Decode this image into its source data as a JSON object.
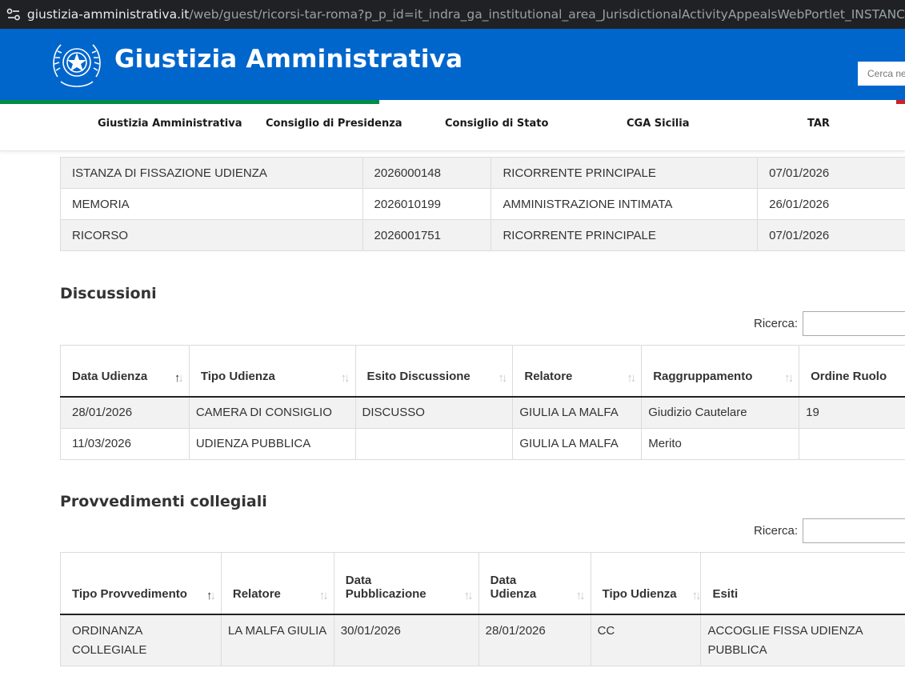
{
  "browser": {
    "url_domain": "giustizia-amministrativa.it",
    "url_path": "/web/guest/ricorsi-tar-roma?p_p_id=it_indra_ga_institutional_area_JurisdictionalActivityAppealsWebPortlet_INSTANC"
  },
  "header": {
    "title": "Giustizia Amministrativa",
    "search_placeholder": "Cerca ne",
    "colors": {
      "blue": "#0066cc",
      "green": "#008c45",
      "red": "#cd212a"
    }
  },
  "nav": {
    "items": [
      "Giustizia Amministrativa",
      "Consiglio di Presidenza",
      "Consiglio di Stato",
      "CGA Sicilia",
      "TAR"
    ]
  },
  "atti": {
    "rows": [
      [
        "ISTANZA DI FISSAZIONE UDIENZA",
        "2026000148",
        "RICORRENTE PRINCIPALE",
        "07/01/2026"
      ],
      [
        "MEMORIA",
        "2026010199",
        "AMMINISTRAZIONE INTIMATA",
        "26/01/2026"
      ],
      [
        "RICORSO",
        "2026001751",
        "RICORRENTE PRINCIPALE",
        "07/01/2026"
      ]
    ]
  },
  "discussioni": {
    "title": "Discussioni",
    "search_label": "Ricerca:",
    "headers": [
      "Data Udienza",
      "Tipo Udienza",
      "Esito Discussione",
      "Relatore",
      "Raggruppamento",
      "Ordine Ruolo"
    ],
    "rows": [
      [
        "28/01/2026",
        "CAMERA DI CONSIGLIO",
        "DISCUSSO",
        "GIULIA LA MALFA",
        "Giudizio Cautelare",
        "19"
      ],
      [
        "11/03/2026",
        "UDIENZA PUBBLICA",
        "",
        "GIULIA LA MALFA",
        "Merito",
        ""
      ]
    ]
  },
  "provvedimenti": {
    "title": "Provvedimenti collegiali",
    "search_label": "Ricerca:",
    "headers": [
      [
        "Tipo Provvedimento"
      ],
      [
        "Relatore"
      ],
      [
        "Data",
        "Pubblicazione"
      ],
      [
        "Data",
        "Udienza"
      ],
      [
        "Tipo Udienza"
      ],
      [
        "Esiti"
      ]
    ],
    "rows": [
      [
        [
          "ORDINANZA",
          "COLLEGIALE"
        ],
        [
          "LA MALFA GIULIA"
        ],
        [
          "30/01/2026"
        ],
        [
          "28/01/2026"
        ],
        [
          "CC"
        ],
        [
          "ACCOGLIE FISSA UDIENZA",
          "PUBBLICA"
        ]
      ]
    ]
  }
}
